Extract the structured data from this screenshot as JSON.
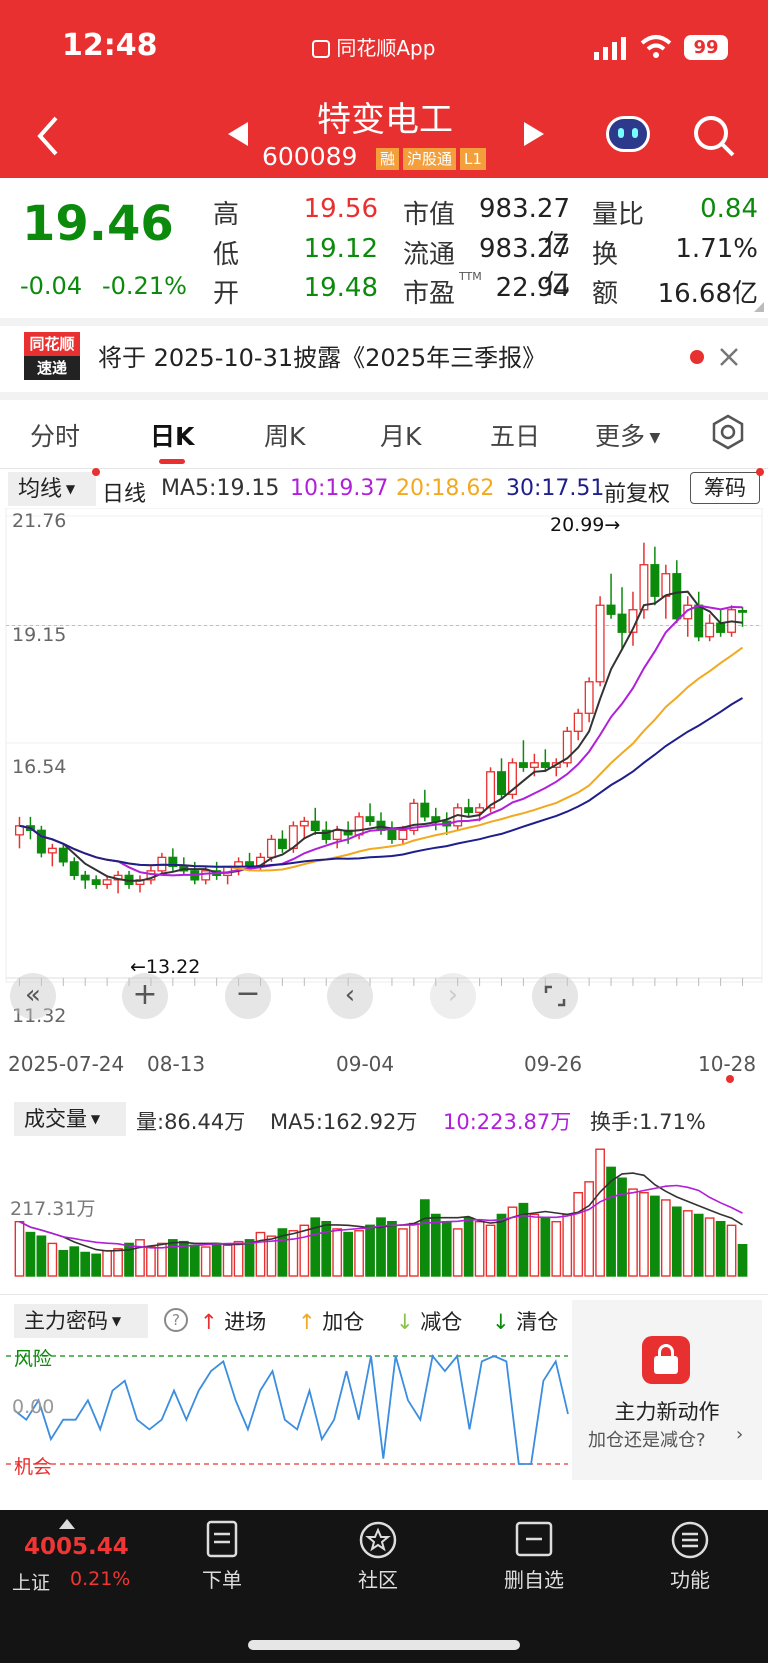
{
  "status_bar": {
    "time": "12:48",
    "app": "同花顺App",
    "battery": "99"
  },
  "stock": {
    "name": "特变电工",
    "code": "600089",
    "badges": [
      "融",
      "沪股通",
      "L1"
    ]
  },
  "quote": {
    "price": "19.46",
    "change": "-0.04",
    "change_pct": "-0.21%",
    "high_label": "高",
    "high": "19.56",
    "low_label": "低",
    "low": "19.12",
    "open_label": "开",
    "open": "19.48",
    "mcap_label": "市值",
    "mcap": "983.27亿",
    "float_label": "流通",
    "float": "983.27亿",
    "pe_label": "市盈",
    "pe_sup": "TTM",
    "pe": "22.94",
    "vr_label": "量比",
    "vr": "0.84",
    "turn_label": "换",
    "turn": "1.71%",
    "amt_label": "额",
    "amt": "16.68亿"
  },
  "notice": {
    "logo_top": "同花顺",
    "logo_bottom": "速递",
    "text": "将于 2025-10-31披露《2025年三季报》"
  },
  "tabs": [
    "分时",
    "日K",
    "周K",
    "月K",
    "五日",
    "更多"
  ],
  "active_tab": "日K",
  "ma_bar": {
    "select": "均线",
    "period": "日线",
    "ma5": "MA5:19.15",
    "ma10": "10:19.37",
    "ma20": "20:18.62",
    "ma30": "30:17.51",
    "adjust": "前复权",
    "chips": "筹码"
  },
  "colors": {
    "red": "#e93030",
    "green": "#0c8a0c",
    "ma5": "#333333",
    "ma10": "#b01fd9",
    "ma20": "#f2a91f",
    "ma30": "#1e1e8c",
    "t_mark": "#f7a25a",
    "b_mark": "#e8606a",
    "s_mark": "#5aa7e6"
  },
  "kline": {
    "y_labels": [
      "21.76",
      "19.15",
      "16.54",
      "11.32"
    ],
    "max_label": "20.99→",
    "min_label": "←13.22",
    "x_labels": [
      "2025-07-24",
      "08-13",
      "09-04",
      "09-26",
      "10-28"
    ]
  },
  "volume": {
    "select": "成交量",
    "vol": "量:86.44万",
    "ma5": "MA5:162.92万",
    "ma10": "10:223.87万",
    "turn": "换手:1.71%",
    "y_label": "217.31万"
  },
  "zl": {
    "select": "主力密码",
    "legend": [
      "进场",
      "加仓",
      "减仓",
      "清仓"
    ],
    "risk": "风险",
    "zero": "0.00",
    "chance": "机会",
    "promo_title": "主力新动作",
    "promo_sub": "加仓还是减仓?"
  },
  "bottom": {
    "index_value": "4005.44",
    "index_name": "上证",
    "index_pct": "0.21%",
    "items": [
      "下单",
      "社区",
      "删自选",
      "功能"
    ]
  },
  "chart_data": {
    "type": "candlestick",
    "title": "特变电工 日K",
    "x_start": "2025-07-24",
    "x_end": "2025-10-28",
    "ylim": [
      11.32,
      21.76
    ],
    "candles": [
      [
        14.5,
        14.9,
        14.2,
        14.7
      ],
      [
        14.7,
        14.9,
        14.4,
        14.6
      ],
      [
        14.6,
        14.7,
        14.0,
        14.1
      ],
      [
        14.1,
        14.3,
        13.8,
        14.2
      ],
      [
        14.2,
        14.3,
        13.8,
        13.9
      ],
      [
        13.9,
        14.0,
        13.5,
        13.6
      ],
      [
        13.6,
        13.7,
        13.3,
        13.5
      ],
      [
        13.5,
        13.6,
        13.3,
        13.4
      ],
      [
        13.4,
        13.6,
        13.3,
        13.5
      ],
      [
        13.5,
        13.7,
        13.2,
        13.6
      ],
      [
        13.6,
        13.7,
        13.3,
        13.4
      ],
      [
        13.4,
        13.6,
        13.22,
        13.5
      ],
      [
        13.5,
        13.8,
        13.4,
        13.7
      ],
      [
        13.7,
        14.1,
        13.6,
        14.0
      ],
      [
        14.0,
        14.2,
        13.7,
        13.8
      ],
      [
        13.8,
        14.0,
        13.6,
        13.7
      ],
      [
        13.7,
        13.9,
        13.4,
        13.5
      ],
      [
        13.5,
        13.8,
        13.4,
        13.7
      ],
      [
        13.7,
        13.9,
        13.5,
        13.6
      ],
      [
        13.6,
        13.8,
        13.4,
        13.8
      ],
      [
        13.8,
        14.0,
        13.6,
        13.9
      ],
      [
        13.9,
        14.1,
        13.7,
        13.8
      ],
      [
        13.8,
        14.1,
        13.7,
        14.0
      ],
      [
        14.0,
        14.5,
        13.9,
        14.4
      ],
      [
        14.4,
        14.6,
        14.1,
        14.2
      ],
      [
        14.2,
        14.8,
        14.1,
        14.7
      ],
      [
        14.7,
        14.9,
        14.4,
        14.8
      ],
      [
        14.8,
        15.1,
        14.5,
        14.6
      ],
      [
        14.6,
        14.8,
        14.3,
        14.4
      ],
      [
        14.4,
        14.7,
        14.2,
        14.6
      ],
      [
        14.6,
        14.8,
        14.3,
        14.5
      ],
      [
        14.5,
        15.0,
        14.4,
        14.9
      ],
      [
        14.9,
        15.2,
        14.7,
        14.8
      ],
      [
        14.8,
        15.0,
        14.5,
        14.6
      ],
      [
        14.6,
        14.8,
        14.3,
        14.4
      ],
      [
        14.4,
        14.7,
        14.3,
        14.6
      ],
      [
        14.6,
        15.3,
        14.5,
        15.2
      ],
      [
        15.2,
        15.5,
        14.8,
        14.9
      ],
      [
        14.9,
        15.1,
        14.6,
        14.8
      ],
      [
        14.8,
        15.0,
        14.5,
        14.7
      ],
      [
        14.7,
        15.2,
        14.6,
        15.1
      ],
      [
        15.1,
        15.3,
        14.9,
        15.0
      ],
      [
        15.0,
        15.2,
        14.8,
        15.1
      ],
      [
        15.1,
        16.0,
        15.0,
        15.9
      ],
      [
        15.9,
        16.2,
        15.3,
        15.4
      ],
      [
        15.4,
        16.2,
        15.3,
        16.1
      ],
      [
        16.1,
        16.6,
        15.9,
        16.0
      ],
      [
        16.0,
        16.3,
        15.8,
        16.1
      ],
      [
        16.1,
        16.4,
        15.9,
        16.0
      ],
      [
        16.0,
        16.2,
        15.8,
        16.1
      ],
      [
        16.1,
        16.9,
        16.0,
        16.8
      ],
      [
        16.8,
        17.3,
        16.6,
        17.2
      ],
      [
        17.2,
        18.0,
        17.0,
        17.9
      ],
      [
        17.9,
        19.8,
        17.8,
        19.6
      ],
      [
        19.6,
        20.3,
        19.3,
        19.4
      ],
      [
        19.4,
        20.0,
        18.6,
        19.0
      ],
      [
        19.0,
        19.9,
        18.7,
        19.5
      ],
      [
        19.5,
        20.99,
        19.3,
        20.5
      ],
      [
        20.5,
        20.9,
        19.6,
        19.8
      ],
      [
        19.8,
        20.5,
        19.3,
        20.3
      ],
      [
        20.3,
        20.6,
        19.2,
        19.3
      ],
      [
        19.3,
        19.8,
        18.9,
        19.6
      ],
      [
        19.6,
        19.9,
        18.8,
        18.9
      ],
      [
        18.9,
        19.4,
        18.8,
        19.2
      ],
      [
        19.2,
        19.5,
        18.9,
        19.0
      ],
      [
        19.0,
        19.6,
        18.9,
        19.5
      ],
      [
        19.48,
        19.56,
        19.12,
        19.46
      ]
    ],
    "volume_ma_note": "MA5:162.92万 10:223.87万",
    "volumes": [
      150,
      120,
      110,
      90,
      70,
      80,
      65,
      60,
      70,
      75,
      90,
      100,
      80,
      90,
      100,
      95,
      85,
      80,
      90,
      85,
      95,
      100,
      120,
      110,
      130,
      125,
      140,
      160,
      150,
      130,
      120,
      125,
      140,
      160,
      150,
      130,
      145,
      210,
      170,
      150,
      130,
      160,
      150,
      140,
      170,
      190,
      200,
      170,
      160,
      150,
      170,
      230,
      260,
      350,
      300,
      270,
      240,
      230,
      220,
      210,
      190,
      180,
      170,
      160,
      150,
      140,
      86.44
    ]
  }
}
